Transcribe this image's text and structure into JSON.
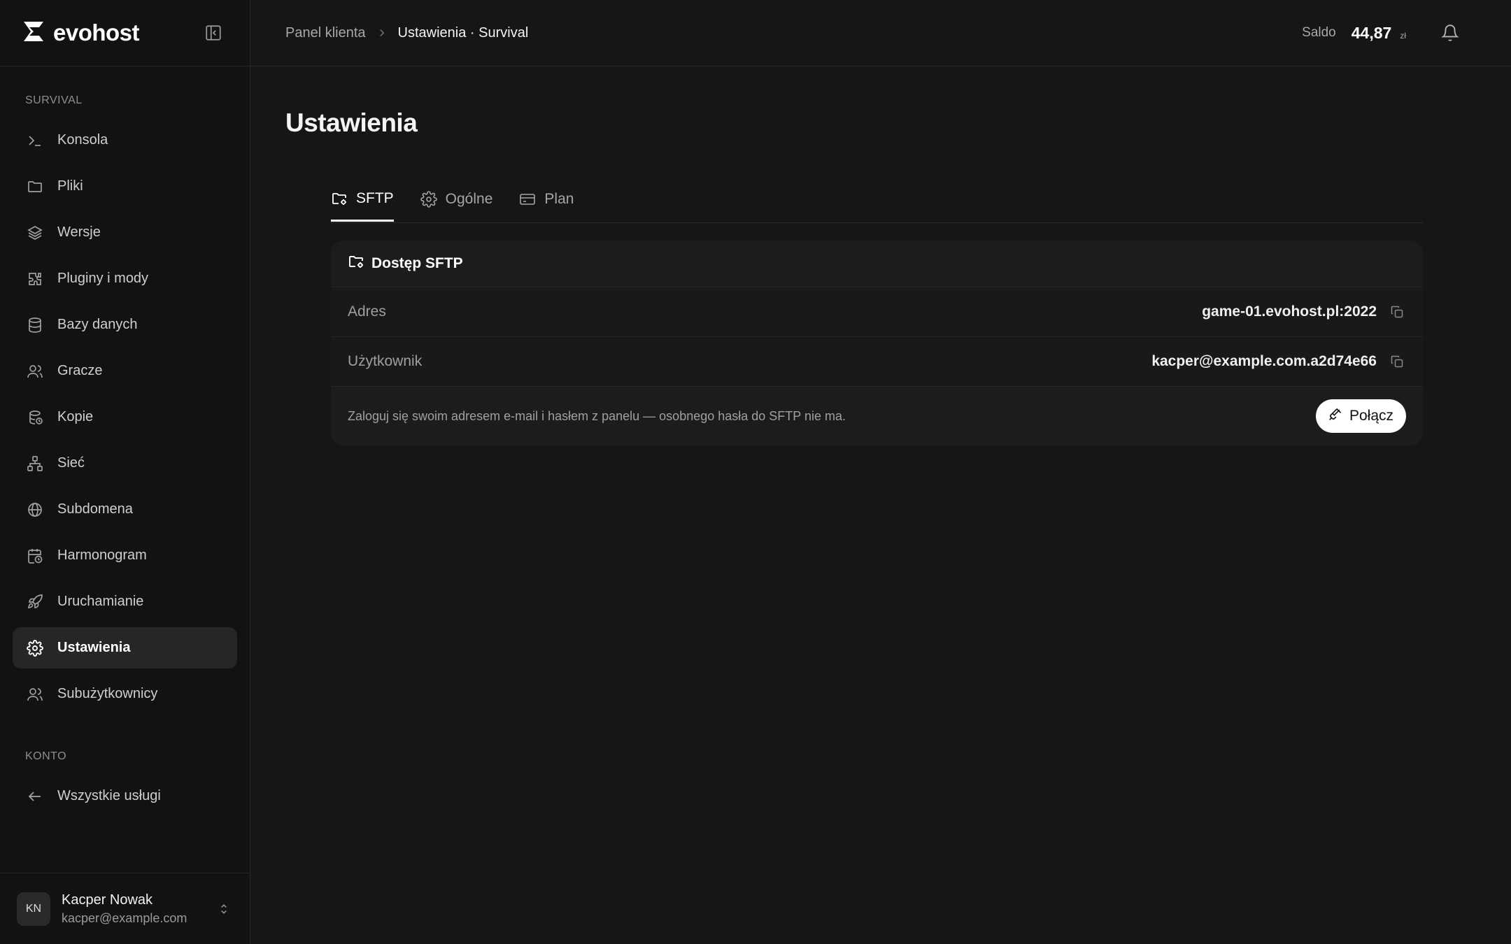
{
  "brand": {
    "name": "evohost"
  },
  "sidebar": {
    "section_server": "SURVIVAL",
    "items": [
      {
        "label": "Konsola",
        "icon": "terminal-icon"
      },
      {
        "label": "Pliki",
        "icon": "folder-icon"
      },
      {
        "label": "Wersje",
        "icon": "layers-icon"
      },
      {
        "label": "Pluginy i mody",
        "icon": "puzzle-icon"
      },
      {
        "label": "Bazy danych",
        "icon": "database-icon"
      },
      {
        "label": "Gracze",
        "icon": "users-icon"
      },
      {
        "label": "Kopie",
        "icon": "backup-icon"
      },
      {
        "label": "Sieć",
        "icon": "network-icon"
      },
      {
        "label": "Subdomena",
        "icon": "globe-icon"
      },
      {
        "label": "Harmonogram",
        "icon": "calendar-clock-icon"
      },
      {
        "label": "Uruchamianie",
        "icon": "rocket-icon"
      },
      {
        "label": "Ustawienia",
        "icon": "gear-icon",
        "active": true
      },
      {
        "label": "Subużytkownicy",
        "icon": "users-icon"
      }
    ],
    "section_account": "KONTO",
    "account_items": [
      {
        "label": "Wszystkie usługi",
        "icon": "arrow-left-icon"
      }
    ],
    "user": {
      "initials": "KN",
      "name": "Kacper Nowak",
      "email": "kacper@example.com"
    }
  },
  "header": {
    "breadcrumb_root": "Panel klienta",
    "breadcrumb_current": "Ustawienia · Survival",
    "saldo_label": "Saldo",
    "saldo_value": "44,87",
    "saldo_currency": "zł"
  },
  "page": {
    "title": "Ustawienia",
    "tabs": [
      {
        "label": "SFTP",
        "icon": "folder-settings-icon",
        "active": true
      },
      {
        "label": "Ogólne",
        "icon": "gear-icon"
      },
      {
        "label": "Plan",
        "icon": "credit-card-icon"
      }
    ],
    "sftp": {
      "card_title": "Dostęp SFTP",
      "address_label": "Adres",
      "address_value": "game-01.evohost.pl:2022",
      "user_label": "Użytkownik",
      "user_value": "kacper@example.com.a2d74e66",
      "note": "Zaloguj się swoim adresem e-mail i hasłem z panelu — osobnego hasła do SFTP nie ma.",
      "connect_label": "Połącz"
    }
  }
}
